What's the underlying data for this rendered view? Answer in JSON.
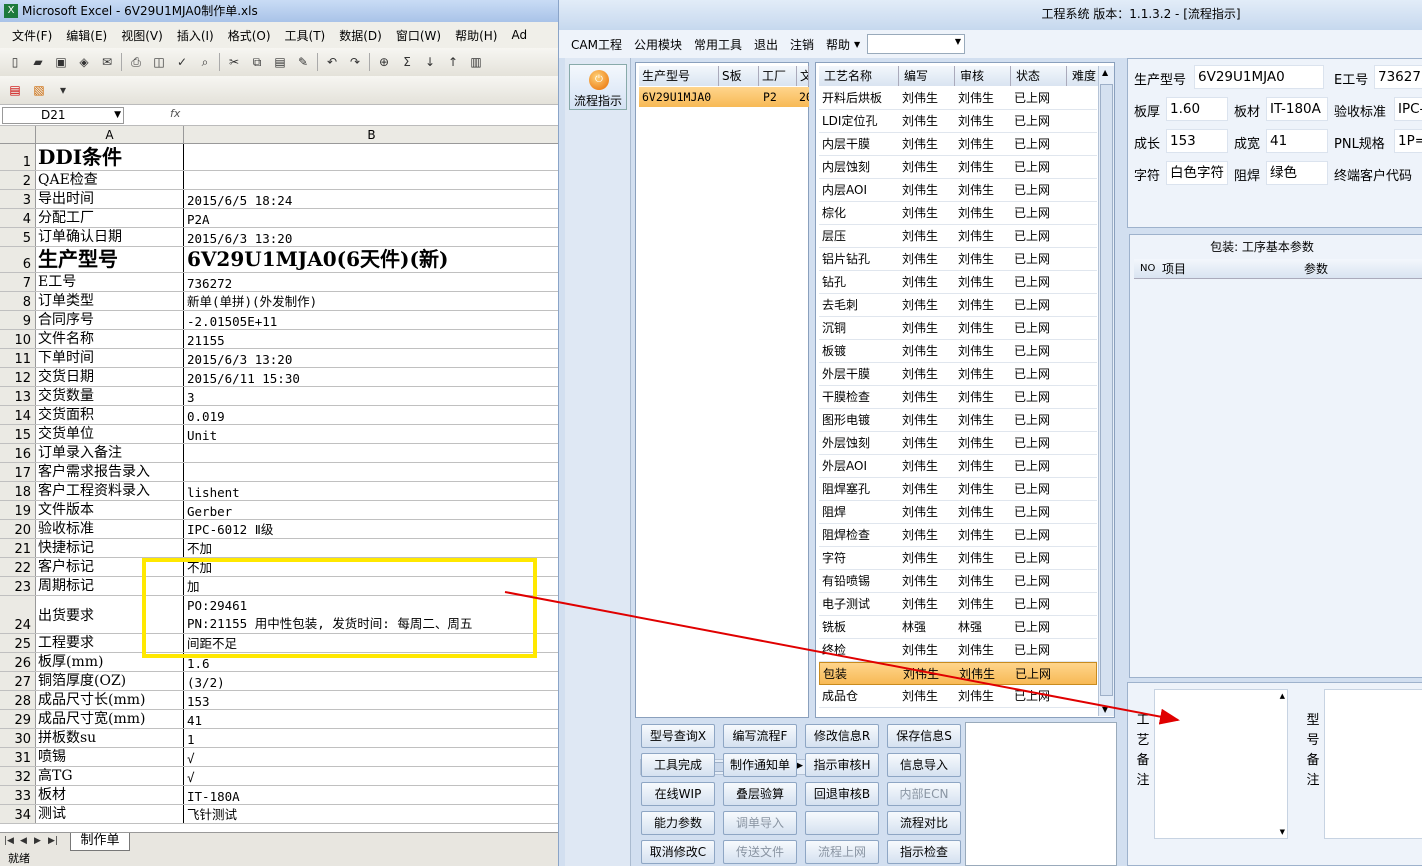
{
  "excel": {
    "title": "Microsoft Excel - 6V29U1MJA0制作单.xls",
    "menu": [
      "文件(F)",
      "编辑(E)",
      "视图(V)",
      "插入(I)",
      "格式(O)",
      "工具(T)",
      "数据(D)",
      "窗口(W)",
      "帮助(H)",
      "Ad"
    ],
    "name_box": "D21",
    "fx": "fx",
    "columns": [
      "A",
      "B"
    ],
    "rows": [
      {
        "n": "1",
        "a": "DDI条件",
        "b": "",
        "big": true
      },
      {
        "n": "2",
        "a": "QAE检查",
        "b": ""
      },
      {
        "n": "3",
        "a": "导出时间",
        "b": "2015/6/5 18:24"
      },
      {
        "n": "4",
        "a": "分配工厂",
        "b": "P2A"
      },
      {
        "n": "5",
        "a": "订单确认日期",
        "b": "2015/6/3 13:20"
      },
      {
        "n": "6",
        "a": "生产型号",
        "b": "6V29U1MJA0(6天件)(新)",
        "big": true
      },
      {
        "n": "7",
        "a": "E工号",
        "b": "736272"
      },
      {
        "n": "8",
        "a": "订单类型",
        "b": "新单(单拼)(外发制作)"
      },
      {
        "n": "9",
        "a": "合同序号",
        "b": "-2.01505E+11"
      },
      {
        "n": "10",
        "a": "文件名称",
        "b": "21155"
      },
      {
        "n": "11",
        "a": "下单时间",
        "b": "2015/6/3 13:20"
      },
      {
        "n": "12",
        "a": "交货日期",
        "b": "2015/6/11 15:30"
      },
      {
        "n": "13",
        "a": "交货数量",
        "b": "3"
      },
      {
        "n": "14",
        "a": "交货面积",
        "b": "0.019"
      },
      {
        "n": "15",
        "a": "交货单位",
        "b": "Unit"
      },
      {
        "n": "16",
        "a": "订单录入备注",
        "b": ""
      },
      {
        "n": "17",
        "a": "客户需求报告录入",
        "b": ""
      },
      {
        "n": "18",
        "a": "客户工程资料录入",
        "b": "lishent"
      },
      {
        "n": "19",
        "a": "文件版本",
        "b": "Gerber"
      },
      {
        "n": "20",
        "a": "验收标准",
        "b": "IPC-6012 Ⅱ级"
      },
      {
        "n": "21",
        "a": "快捷标记",
        "b": "不加"
      },
      {
        "n": "22",
        "a": "客户标记",
        "b": "不加"
      },
      {
        "n": "23",
        "a": "周期标记",
        "b": "加"
      },
      {
        "n": "24",
        "a": "出货要求",
        "b": "PO:29461",
        "b2": "PN:21155 用中性包装, 发货时间: 每周二、周五"
      },
      {
        "n": "25",
        "a": "工程要求",
        "b": "间距不足"
      },
      {
        "n": "26",
        "a": "板厚(mm)",
        "b": "1.6"
      },
      {
        "n": "27",
        "a": "铜箔厚度(OZ)",
        "b": "(3/2)"
      },
      {
        "n": "28",
        "a": "成品尺寸长(mm)",
        "b": "153"
      },
      {
        "n": "29",
        "a": "成品尺寸宽(mm)",
        "b": "41"
      },
      {
        "n": "30",
        "a": "拼板数su",
        "b": "1"
      },
      {
        "n": "31",
        "a": "喷锡",
        "b": "√"
      },
      {
        "n": "32",
        "a": "高TG",
        "b": "√"
      },
      {
        "n": "33",
        "a": "板材",
        "b": "IT-180A"
      },
      {
        "n": "34",
        "a": "测试",
        "b": "飞针测试"
      }
    ],
    "sheet_tab": "制作单",
    "status": "就绪"
  },
  "eng": {
    "title": "工程系统   版本：1.1.3.2 - [流程指示]",
    "menu": [
      "CAM工程",
      "公用模块",
      "常用工具",
      "退出",
      "注销",
      "帮助"
    ],
    "flow_button": "流程指示",
    "product_headers": [
      "生产型号",
      "S板",
      "工厂",
      "文"
    ],
    "product_row": {
      "model": "6V29U1MJA0",
      "s": "",
      "factory": "P2",
      "doc": "20"
    },
    "process_headers": [
      "工艺名称",
      "编写",
      "审核",
      "状态",
      "难度"
    ],
    "processes": [
      [
        "开料后烘板",
        "刘伟生",
        "刘伟生",
        "已上网"
      ],
      [
        "LDI定位孔",
        "刘伟生",
        "刘伟生",
        "已上网"
      ],
      [
        "内层干膜",
        "刘伟生",
        "刘伟生",
        "已上网"
      ],
      [
        "内层蚀刻",
        "刘伟生",
        "刘伟生",
        "已上网"
      ],
      [
        "内层AOI",
        "刘伟生",
        "刘伟生",
        "已上网"
      ],
      [
        "棕化",
        "刘伟生",
        "刘伟生",
        "已上网"
      ],
      [
        "层压",
        "刘伟生",
        "刘伟生",
        "已上网"
      ],
      [
        "铝片钻孔",
        "刘伟生",
        "刘伟生",
        "已上网"
      ],
      [
        "钻孔",
        "刘伟生",
        "刘伟生",
        "已上网"
      ],
      [
        "去毛刺",
        "刘伟生",
        "刘伟生",
        "已上网"
      ],
      [
        "沉铜",
        "刘伟生",
        "刘伟生",
        "已上网"
      ],
      [
        "板镀",
        "刘伟生",
        "刘伟生",
        "已上网"
      ],
      [
        "外层干膜",
        "刘伟生",
        "刘伟生",
        "已上网"
      ],
      [
        "干膜检查",
        "刘伟生",
        "刘伟生",
        "已上网"
      ],
      [
        "图形电镀",
        "刘伟生",
        "刘伟生",
        "已上网"
      ],
      [
        "外层蚀刻",
        "刘伟生",
        "刘伟生",
        "已上网"
      ],
      [
        "外层AOI",
        "刘伟生",
        "刘伟生",
        "已上网"
      ],
      [
        "阻焊塞孔",
        "刘伟生",
        "刘伟生",
        "已上网"
      ],
      [
        "阻焊",
        "刘伟生",
        "刘伟生",
        "已上网"
      ],
      [
        "阻焊检查",
        "刘伟生",
        "刘伟生",
        "已上网"
      ],
      [
        "字符",
        "刘伟生",
        "刘伟生",
        "已上网"
      ],
      [
        "有铅喷锡",
        "刘伟生",
        "刘伟生",
        "已上网"
      ],
      [
        "电子测试",
        "刘伟生",
        "刘伟生",
        "已上网"
      ],
      [
        "铣板",
        "林强",
        "林强",
        "已上网"
      ],
      [
        "终检",
        "刘伟生",
        "刘伟生",
        "已上网"
      ],
      [
        "包装",
        "刘伟生",
        "刘伟生",
        "已上网"
      ],
      [
        "成品仓",
        "刘伟生",
        "刘伟生",
        "已上网"
      ]
    ],
    "selected_process": 25,
    "buttons": [
      [
        "型号查询X",
        "编写流程F",
        "修改信息R",
        "保存信息S"
      ],
      [
        "工具完成",
        "制作通知单",
        "指示审核H",
        "信息导入"
      ],
      [
        "在线WIP",
        "叠层验算",
        "回退审核B",
        "内部ECN"
      ],
      [
        "能力参数",
        "调单导入",
        "",
        "流程对比"
      ],
      [
        "取消修改C",
        "传送文件",
        "流程上网",
        "指示检查"
      ]
    ],
    "buttons_disabled": [
      "内部ECN",
      "调单导入",
      "传送文件",
      "流程上网"
    ],
    "info": {
      "model_label": "生产型号",
      "model": "6V29U1MJA0",
      "e_label": "E工号",
      "e": "736272",
      "thick_label": "板厚",
      "thick": "1.60",
      "mat_label": "板材",
      "mat": "IT-180A",
      "std_label": "验收标准",
      "std": "IPC-",
      "len_label": "成长",
      "len": "153",
      "wid_label": "成宽",
      "wid": "41",
      "pnl_label": "PNL规格",
      "pnl": "1P=",
      "char_label": "字符",
      "char": "白色字符",
      "mask_label": "阻焊",
      "mask": "绿色",
      "cust_label": "终端客户代码"
    },
    "param_title": "包装: 工序基本参数",
    "param_headers": [
      "NO",
      "项目",
      "参数"
    ],
    "remark1": [
      "工",
      "艺",
      "备",
      "注"
    ],
    "remark2": [
      "型",
      "号",
      "备",
      "注"
    ]
  },
  "colors": {
    "highlight": "#ffe800",
    "arrow": "#e00000",
    "selection": "#f7b955"
  }
}
